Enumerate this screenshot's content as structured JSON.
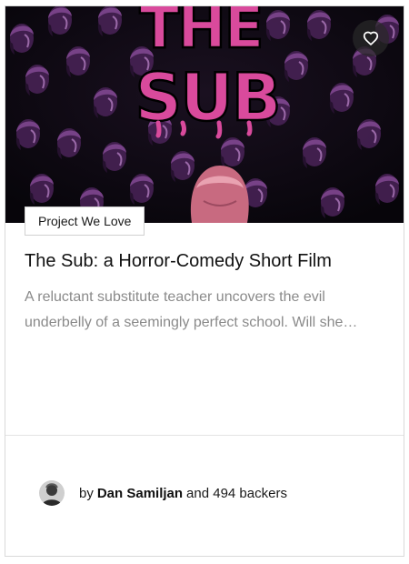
{
  "card": {
    "badge_label": "Project We Love",
    "poster_title": "THE SUB",
    "poster_title_line1": "THE",
    "poster_title_line2": "SUB",
    "title": "The Sub: a Horror-Comedy Short Film",
    "description": "A reluctant substitute teacher uncovers the evil underbelly of a seemingly perfect school. Will she survive?",
    "creator_prefix": "by",
    "creator_name": "Dan Samiljan",
    "backers_text": "and 494 backers",
    "favorite_icon": "heart-outline-icon"
  },
  "colors": {
    "poster_pink": "#d94a9c",
    "poster_bg": "#0b0710",
    "heads": "#6b3a7a",
    "text_primary": "#111111",
    "text_secondary": "#8a8a8a"
  }
}
